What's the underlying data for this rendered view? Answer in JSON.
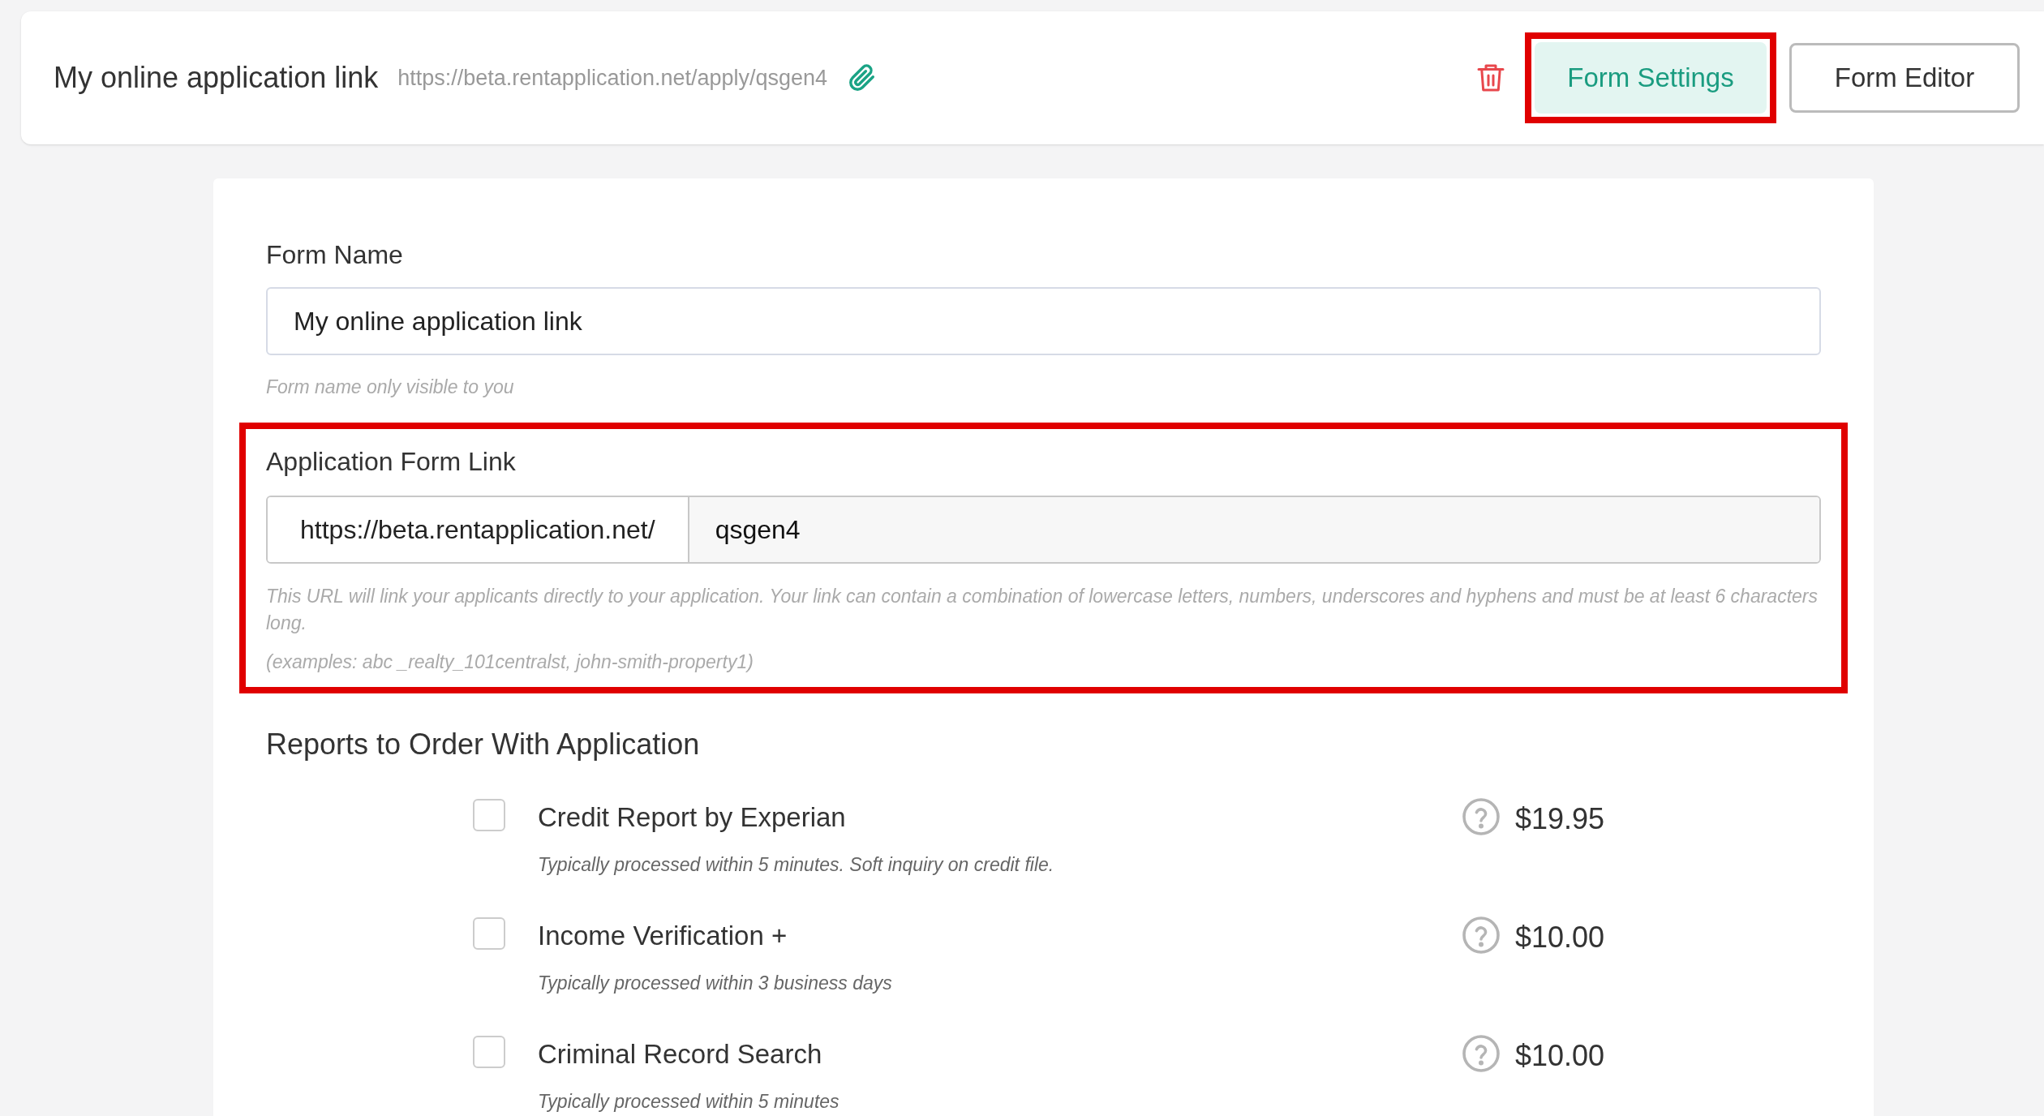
{
  "header": {
    "title": "My online application link",
    "url": "https://beta.rentapplication.net/apply/qsgen4",
    "buttons": [
      {
        "label": "Form Settings",
        "selected": true,
        "highlighted": true
      },
      {
        "label": "Form Editor",
        "selected": false,
        "highlighted": false
      }
    ]
  },
  "form_name": {
    "label": "Form Name",
    "value": "My online application link",
    "hint": "Form name only visible to you"
  },
  "form_link": {
    "highlighted": true,
    "label": "Application Form Link",
    "prefix": "https://beta.rentapplication.net/",
    "value": "qsgen4",
    "hint": "This URL will link your applicants directly to your application. Your link can contain a combination of lowercase letters, numbers, underscores and hyphens and must be at least 6 characters long.",
    "examples": "(examples: abc _realty_101centralst, john-smith-property1)"
  },
  "reports": {
    "title": "Reports to Order With Application",
    "items": [
      {
        "name": "Credit Report by Experian",
        "description": "Typically processed within 5 minutes. Soft inquiry on credit file.",
        "price": "$19.95",
        "checked": false
      },
      {
        "name": "Income Verification +",
        "description": "Typically processed within 3 business days",
        "price": "$10.00",
        "checked": false
      },
      {
        "name": "Criminal Record Search",
        "description": "Typically processed within 5 minutes",
        "price": "$10.00",
        "checked": false
      }
    ]
  }
}
